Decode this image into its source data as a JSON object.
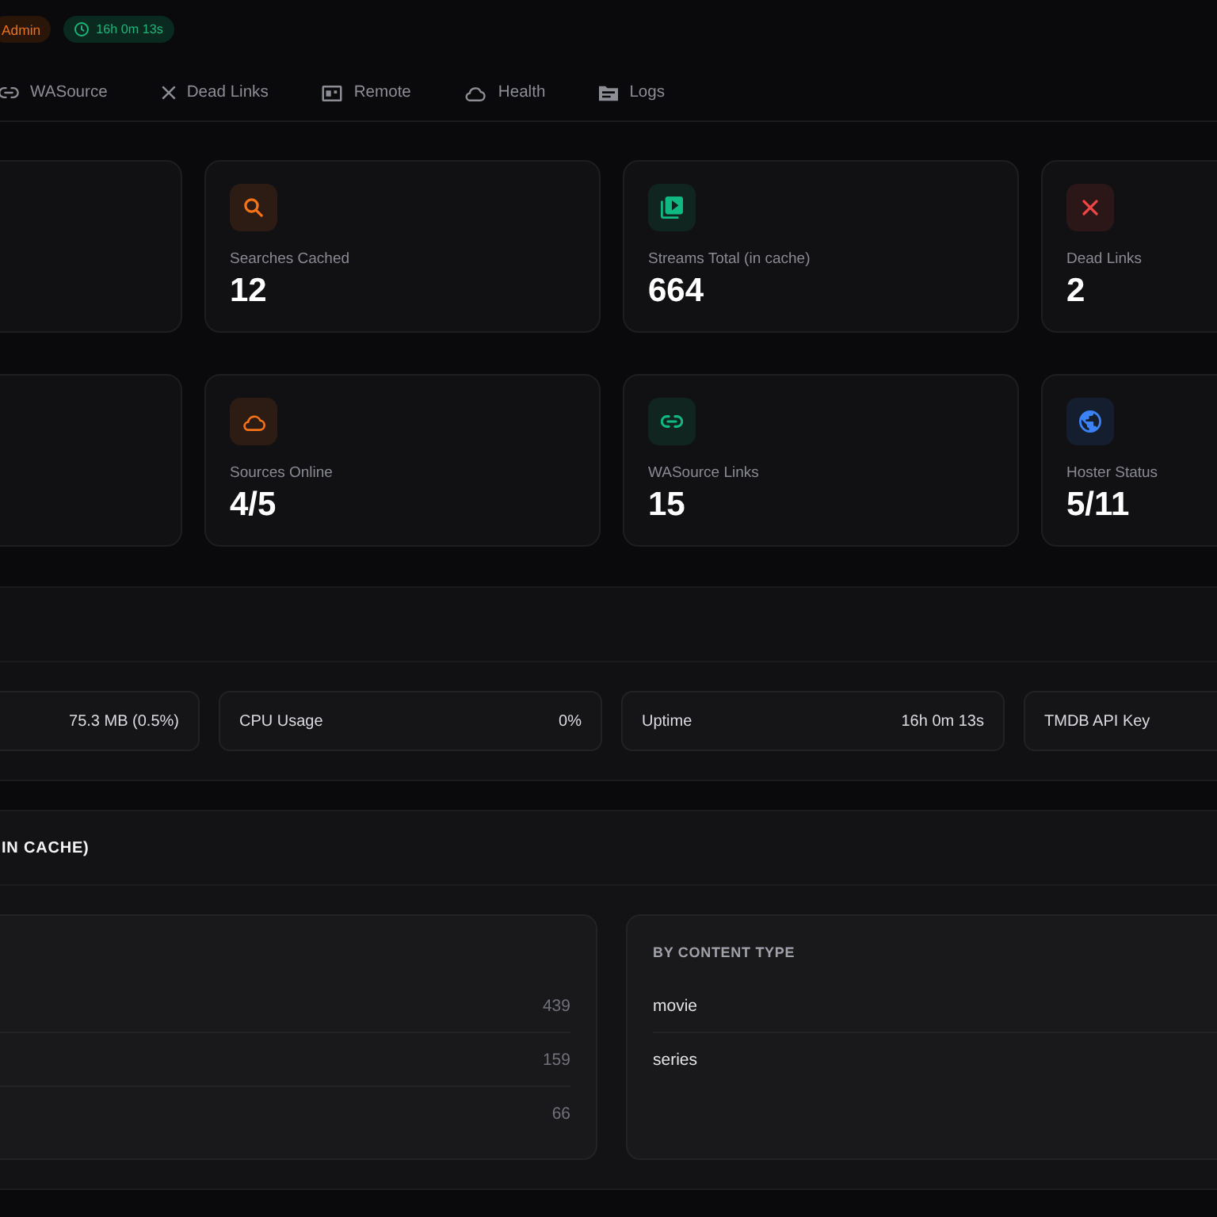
{
  "header": {
    "badges": [
      {
        "kind": "role",
        "text": "Admin"
      },
      {
        "kind": "uptime",
        "text": "16h 0m 13s"
      }
    ]
  },
  "tabs": [
    {
      "label": "WASource",
      "selected": false
    },
    {
      "label": "Dead Links",
      "selected": false
    },
    {
      "label": "Remote",
      "selected": false
    },
    {
      "label": "Health",
      "selected": false
    },
    {
      "label": "Logs",
      "selected": false
    }
  ],
  "stat_rows": [
    {
      "cards": [
        {
          "label": "Searches Cached",
          "value": "12",
          "color": "#f97316"
        },
        {
          "label": "Streams Total (in cache)",
          "value": "664",
          "color": "#10b981"
        },
        {
          "label": "Dead Links",
          "value": "2",
          "color": "#ef4444"
        }
      ]
    },
    {
      "cards": [
        {
          "label": "Sources Online",
          "value": "4/5",
          "color": "#f97316"
        },
        {
          "label": "WASource Links",
          "value": "15",
          "color": "#10b981"
        },
        {
          "label": "Hoster Status",
          "value": "5/11",
          "color": "#3b82f6"
        }
      ]
    }
  ],
  "system_panel": {
    "cards": [
      {
        "value": "75.3 MB (0.5%)"
      },
      {
        "label": "CPU Usage",
        "value": "0%"
      },
      {
        "label": "Uptime",
        "value": "16h 0m 13s"
      },
      {
        "label": "TMDB API Key"
      }
    ]
  },
  "cache_panel": {
    "title": "IN CACHE)",
    "breakdowns": [
      {
        "rows": [
          {
            "count": "439"
          },
          {
            "count": "159"
          },
          {
            "count": "66"
          }
        ]
      },
      {
        "title": "BY CONTENT TYPE",
        "rows": [
          {
            "label": "movie"
          },
          {
            "label": "series"
          }
        ]
      }
    ]
  }
}
